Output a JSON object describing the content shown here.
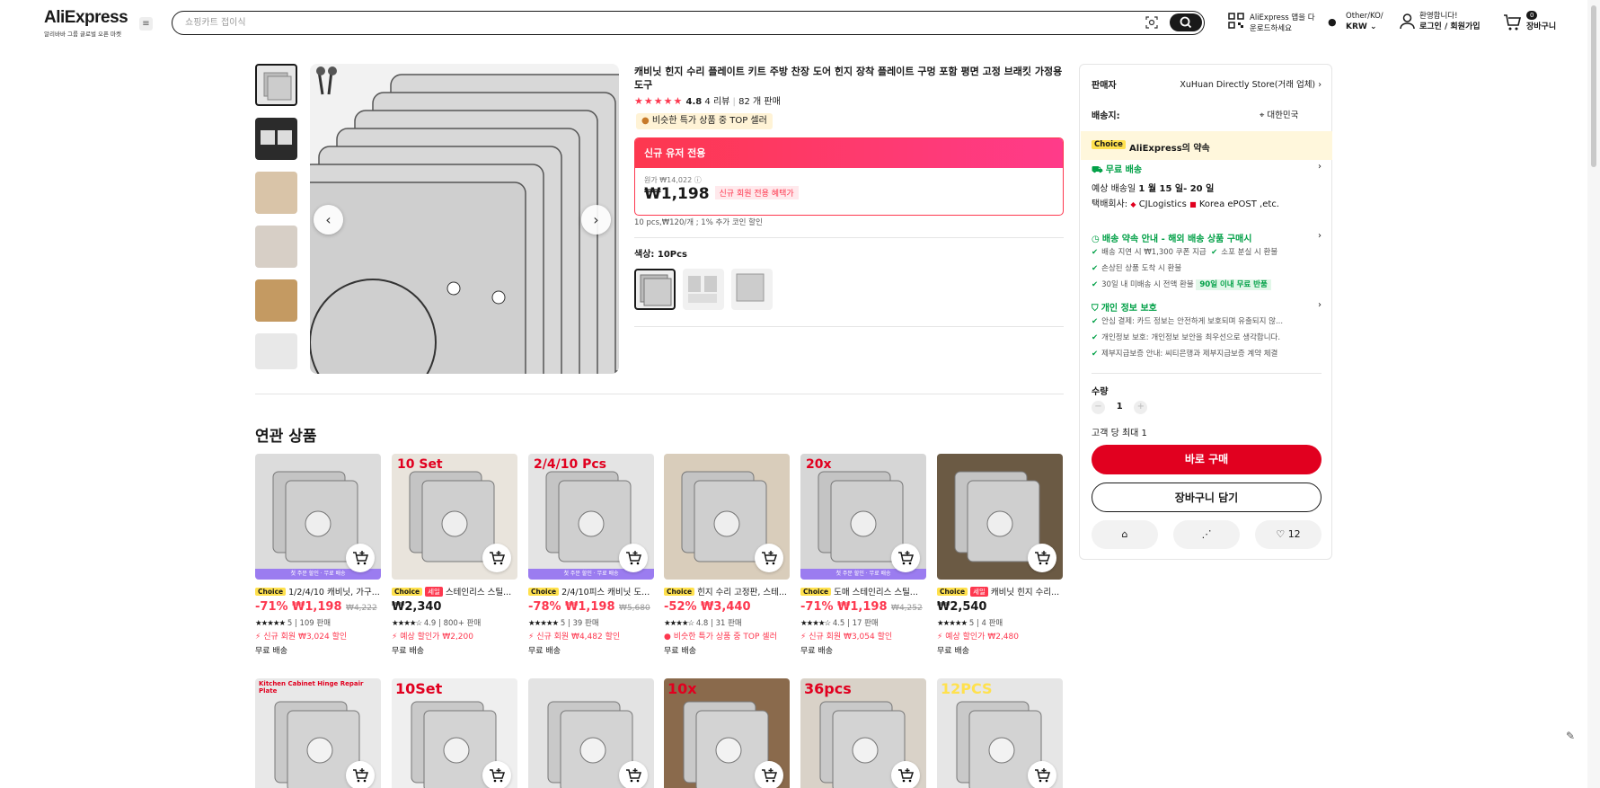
{
  "header": {
    "logo": "AliExpress",
    "tagline": "알리바바 그룹 글로벌 오픈 마켓",
    "search_placeholder": "쇼핑카트 접이식",
    "app_promo": "AliExpress 앱을 다운로드하세요",
    "region_line1": "Other/KO/",
    "region_line2": "KRW",
    "greeting": "환영합니다!",
    "login": "로그인 / 회원가입",
    "cart_count": "0",
    "cart_label": "장바구니"
  },
  "product": {
    "title": "캐비닛 힌지 수리 플레이트 키트 주방 찬장 도어 힌지 장착 플레이트 구멍 포함 평면 고정 브래킷 가정용 도구",
    "rating": "4.8",
    "reviews": "4 리뷰",
    "sold": "82 개 판매",
    "top_badge": "비슷한 특가 상품 중 TOP 셀러",
    "promo_banner": "신규 유저 전용",
    "orig_price": "원가 ₩14,022",
    "price": "₩1,198",
    "price_badge": "신규 회원 전용 혜택가",
    "coin_note": "10 pcs,₩120/개 ; 1% 추가 코인 할인",
    "color_label": "색상: 10Pcs"
  },
  "related": {
    "title": "연관 상품",
    "items": [
      {
        "choice": "Choice",
        "sale": "",
        "title": "1/2/4/10 캐비닛, 가구...",
        "discount": "-71%",
        "price": "₩1,198",
        "was": "₩4,222",
        "stars": "★★★★★",
        "rating_text": "5 | 109 판매",
        "promo": "신규 회원 ₩3,024 할인",
        "promo_icon": "⚡",
        "ship": "무료 배송",
        "strip": "첫 주문 할인 · 무료 배송",
        "overlay": ""
      },
      {
        "choice": "Choice",
        "sale": "세일",
        "title": "스테인리스 스틸...",
        "discount": "",
        "price": "₩2,340",
        "was": "",
        "stars": "★★★★☆",
        "rating_text": "4.9 | 800+ 판매",
        "promo": "예상 할인가 ₩2,200",
        "promo_icon": "⚡",
        "ship": "무료 배송",
        "strip": "",
        "overlay": "10 Set"
      },
      {
        "choice": "Choice",
        "sale": "",
        "title": "2/4/10피스 캐비닛 도...",
        "discount": "-78%",
        "price": "₩1,198",
        "was": "₩5,680",
        "stars": "★★★★★",
        "rating_text": "5 | 39 판매",
        "promo": "신규 회원 ₩4,482 할인",
        "promo_icon": "⚡",
        "ship": "무료 배송",
        "strip": "첫 주문 할인 · 무료 배송",
        "overlay": "2/4/10 Pcs"
      },
      {
        "choice": "Choice",
        "sale": "",
        "title": "힌지 수리 고정판, 스테...",
        "discount": "-52%",
        "price": "₩3,440",
        "was": "",
        "stars": "★★★★☆",
        "rating_text": "4.8 | 31 판매",
        "promo": "비슷한 특가 상품 중 TOP 셀러",
        "promo_icon": "●",
        "ship": "무료 배송",
        "strip": "",
        "overlay": ""
      },
      {
        "choice": "Choice",
        "sale": "",
        "title": "도매 스테인리스 스틸...",
        "discount": "-71%",
        "price": "₩1,198",
        "was": "₩4,252",
        "stars": "★★★★☆",
        "rating_text": "4.5 | 17 판매",
        "promo": "신규 회원 ₩3,054 할인",
        "promo_icon": "⚡",
        "ship": "무료 배송",
        "strip": "첫 주문 할인 · 무료 배송",
        "overlay": "20x"
      },
      {
        "choice": "Choice",
        "sale": "세일",
        "title": "캐비닛 힌지 수리...",
        "discount": "",
        "price": "₩2,540",
        "was": "",
        "stars": "★★★★★",
        "rating_text": "5 | 4 판매",
        "promo": "예상 할인가 ₩2,480",
        "promo_icon": "⚡",
        "ship": "무료 배송",
        "strip": "",
        "overlay": ""
      }
    ],
    "row2_overlays": [
      "Kitchen Cabinet Hinge Repair Plate",
      "10Set",
      "",
      "10x",
      "36pcs",
      "12PCS"
    ]
  },
  "panel": {
    "seller_label": "판매자",
    "seller": "XuHuan Directly Store(거래 업체)",
    "ship_to_label": "배송지:",
    "ship_to": "대한민국",
    "choice": "Choice",
    "promise": "AliExpress의 약속",
    "free_ship": "무료 배송",
    "eta_prefix": "예상 배송일",
    "eta": "1 월 15 일- 20 일",
    "courier_prefix": "택배회사:",
    "courier1": "CJLogistics",
    "courier2": "Korea ePOST ,etc.",
    "guide": "배송 약속 안내 - 해외 배송 상품 구매시",
    "g1": "배송 지연 시 ₩1,300 쿠폰 지급",
    "g2": "소포 분실 시 환불",
    "g3": "손상된 상품 도착 시 환불",
    "g4": "30일 내 미배송 시 전액 환불",
    "g4b": "90일 이내 무료 반품",
    "privacy": "개인 정보 보호",
    "p1": "안심 결제: 카드 정보는 안전하게 보호되며 유출되지 않...",
    "p2": "개인정보 보호: 개인정보 보안을 최우선으로 생각합니다.",
    "p3": "제부지급보증 안내: 씨티은행과 제부지급보증 계약 체결",
    "qty_label": "수량",
    "qty": "1",
    "max_note": "고객 당 최대 1",
    "buy_now": "바로 구매",
    "add_cart": "장바구니 담기",
    "wish_count": "12"
  },
  "colors": {
    "accent": "#fd384f",
    "buy": "#e1001f",
    "green": "#00a046",
    "choice_yellow": "#ffe14d"
  }
}
